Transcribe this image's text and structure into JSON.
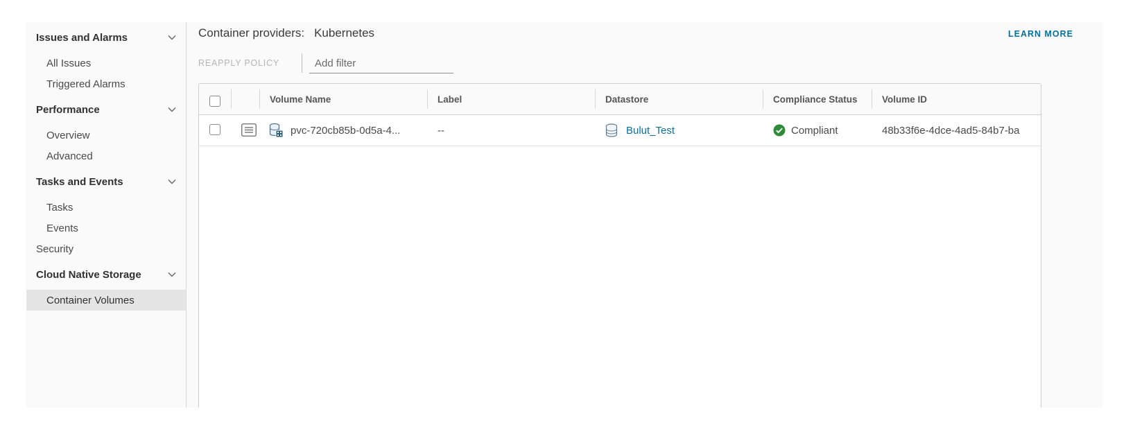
{
  "sidebar": {
    "issues_and_alarms": "Issues and Alarms",
    "all_issues": "All Issues",
    "triggered_alarms": "Triggered Alarms",
    "performance": "Performance",
    "overview": "Overview",
    "advanced": "Advanced",
    "tasks_and_events": "Tasks and Events",
    "tasks": "Tasks",
    "events": "Events",
    "security": "Security",
    "cloud_native_storage": "Cloud Native Storage",
    "container_volumes": "Container Volumes"
  },
  "header": {
    "label": "Container providers:",
    "value": "Kubernetes",
    "learn_more": "LEARN MORE"
  },
  "toolbar": {
    "reapply_policy": "REAPPLY POLICY",
    "filter_placeholder": "Add filter"
  },
  "table": {
    "columns": [
      "Volume Name",
      "Label",
      "Datastore",
      "Compliance Status",
      "Volume ID"
    ],
    "rows": [
      {
        "volume_name": "pvc-720cb85b-0d5a-4...",
        "label": "--",
        "datastore": "Bulut_Test",
        "compliance_status": "Compliant",
        "volume_id": "48b33f6e-4dce-4ad5-84b7-ba"
      }
    ]
  },
  "colors": {
    "link": "#0072a3",
    "compliant": "#2e8b36",
    "active_bg": "#e5e5e5"
  },
  "icons": [
    "chevron-down-icon",
    "details-icon",
    "volume-icon",
    "datastore-icon",
    "check-circle-icon"
  ]
}
